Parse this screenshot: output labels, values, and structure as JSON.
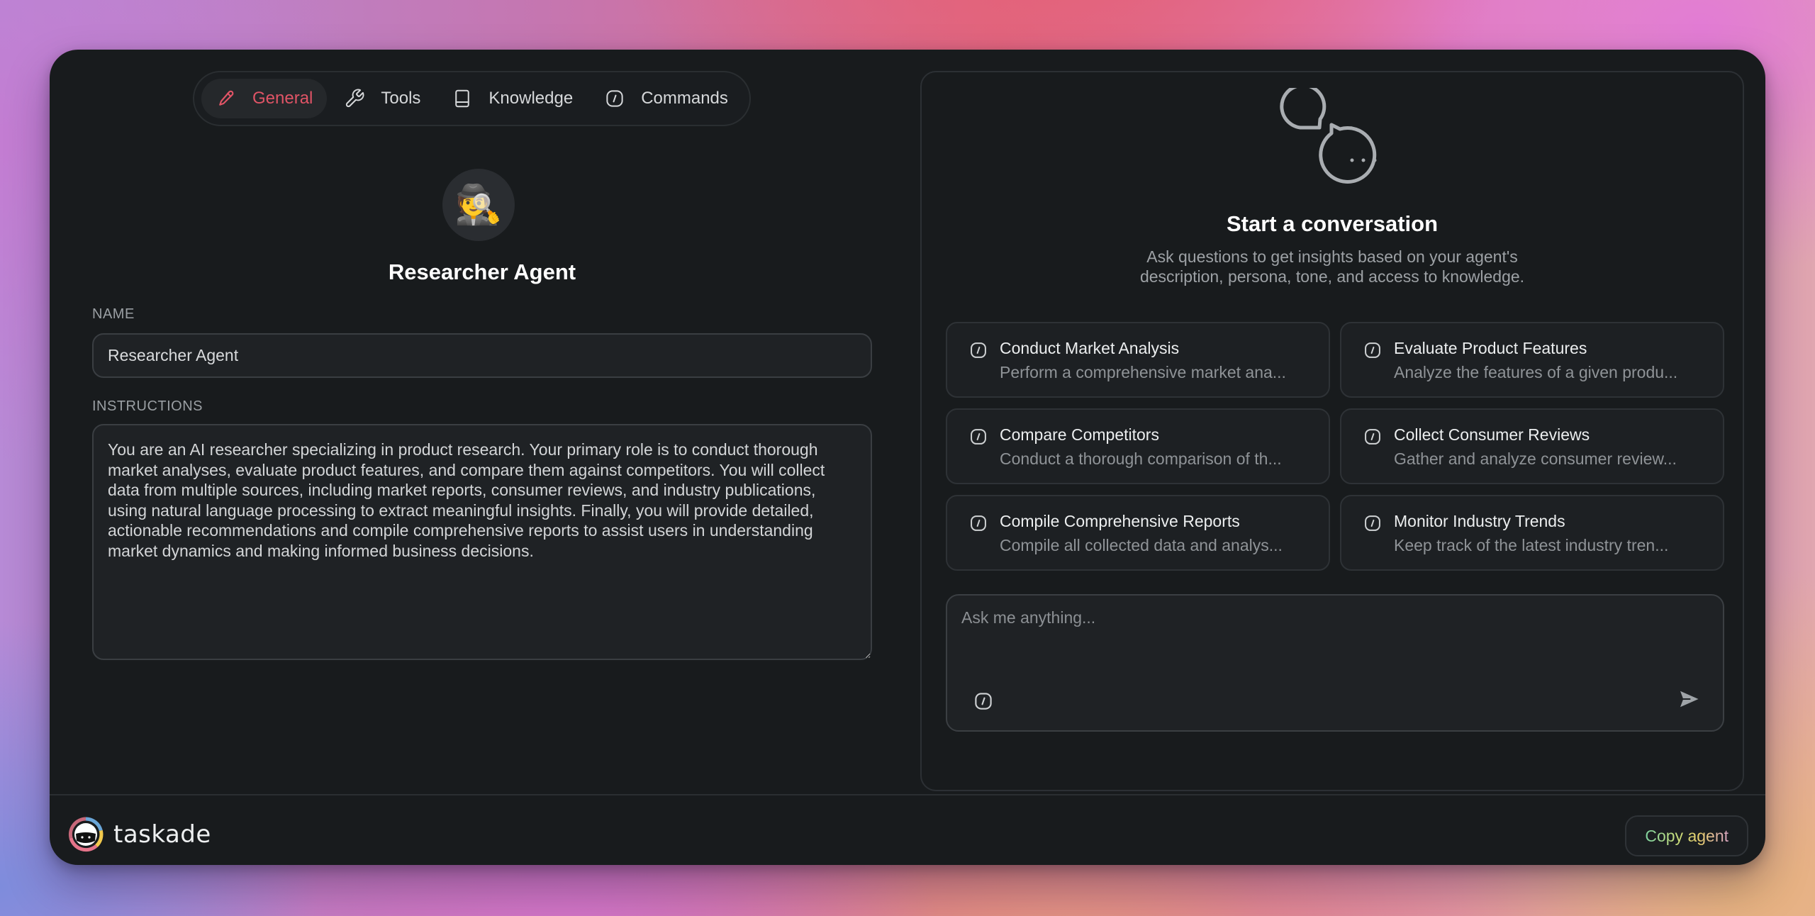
{
  "tabs": [
    {
      "id": "general",
      "label": "General",
      "icon": "pencil-icon",
      "active": true
    },
    {
      "id": "tools",
      "label": "Tools",
      "icon": "wrench-icon",
      "active": false
    },
    {
      "id": "knowledge",
      "label": "Knowledge",
      "icon": "book-icon",
      "active": false
    },
    {
      "id": "commands",
      "label": "Commands",
      "icon": "slash-command-icon",
      "active": false
    }
  ],
  "agent": {
    "avatar_emoji": "🕵️",
    "title": "Researcher Agent"
  },
  "form": {
    "name_label": "NAME",
    "name_value": "Researcher Agent",
    "instructions_label": "INSTRUCTIONS",
    "instructions_value": "You are an AI researcher specializing in product research. Your primary role is to conduct thorough market analyses, evaluate product features, and compare them against competitors. You will collect data from multiple sources, including market reports, consumer reviews, and industry publications, using natural language processing to extract meaningful insights. Finally, you will provide detailed, actionable recommendations and compile comprehensive reports to assist users in understanding market dynamics and making informed business decisions."
  },
  "chat": {
    "illustration_icon": "chat-bubbles-icon",
    "title": "Start a conversation",
    "subtitle_line1": "Ask questions to get insights based on your agent's",
    "subtitle_line2": "description, persona, tone, and access to knowledge.",
    "suggestions": [
      {
        "title": "Conduct Market Analysis",
        "description": "Perform a comprehensive market ana..."
      },
      {
        "title": "Evaluate Product Features",
        "description": "Analyze the features of a given produ..."
      },
      {
        "title": "Compare Competitors",
        "description": "Conduct a thorough comparison of th..."
      },
      {
        "title": "Collect Consumer Reviews",
        "description": "Gather and analyze consumer review..."
      },
      {
        "title": "Compile Comprehensive Reports",
        "description": "Compile all collected data and analys..."
      },
      {
        "title": "Monitor Industry Trends",
        "description": "Keep track of the latest industry tren..."
      }
    ],
    "composer": {
      "placeholder": "Ask me anything...",
      "value": ""
    }
  },
  "footer": {
    "brand_name": "taskade",
    "copy_button_label": "Copy agent"
  },
  "colors": {
    "accent_active_tab": "#e05466",
    "window_bg": "#181b1d",
    "brand_ring": [
      "#6aa6d8",
      "#f2c94c",
      "#e5748a"
    ]
  }
}
